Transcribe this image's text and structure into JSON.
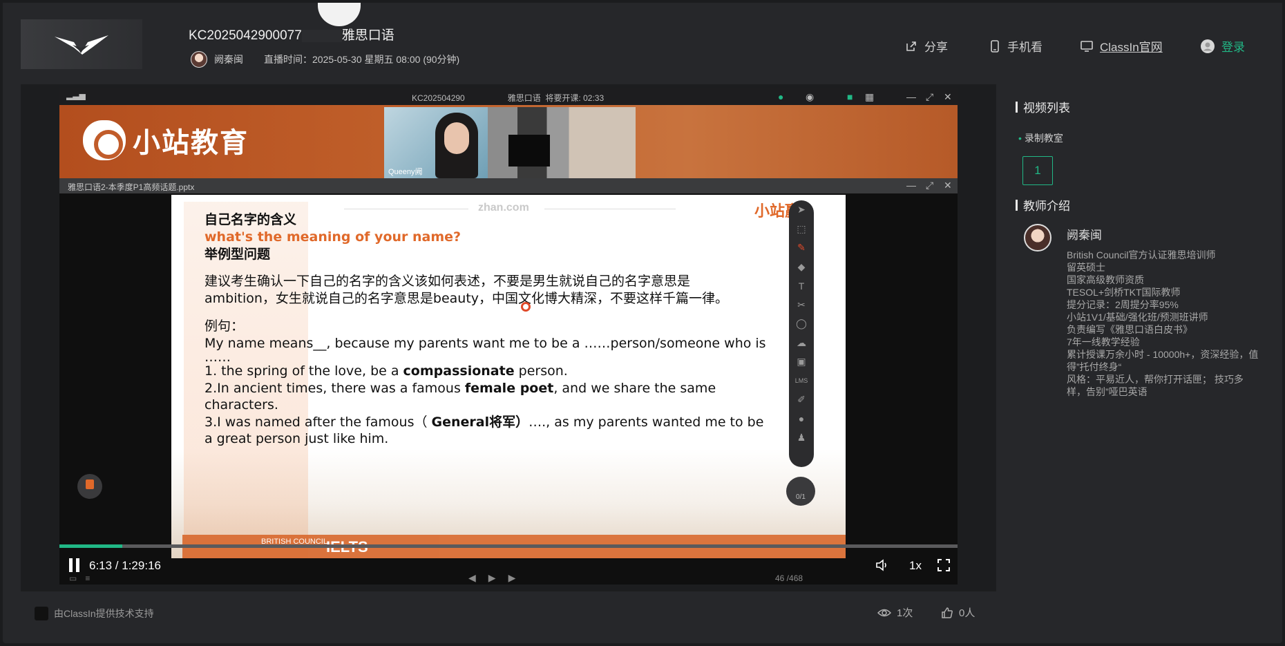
{
  "header": {
    "course_title_left": "KC2025042900077",
    "course_title_right": "雅思口语",
    "teacher": "阙秦闽",
    "broadcast_label": "直播时间：",
    "broadcast_time": "2025-05-30 星期五 08:00 (90分钟)",
    "share": "分享",
    "mobile": "手机看",
    "official": "ClassIn官网",
    "login": "登录"
  },
  "player": {
    "topbar_title_left": "KC202504290",
    "topbar_title_right": "雅思口语",
    "topbar_countdown": "将要开课: 02:33",
    "brand": "小站教育",
    "cam_name": "Queeny阙",
    "doc_filename": "雅思口语2-本季度P1高频话题.pptx",
    "slide": {
      "site": "zhan.com",
      "logo": "小站赢+",
      "heading_cn": "自己名字的含义",
      "heading_en": "what's the meaning of your name?",
      "type": "举例型问题",
      "advice_1": "建议考生确认一下自己的名字的含义该如何表述，不要是男生就说自己的名字意思是",
      "advice_2": "ambition，女生就说自己的名字意思是beauty，中国文化博大精深，不要这样千篇一律。",
      "example_label": "例句：",
      "ex_line1": "My name means__, because my parents want me to be a ……person/someone who is",
      "ex_line2": "……",
      "ex1_a": "1. the spring of the love, be a ",
      "ex1_b": "compassionate",
      "ex1_c": " person.",
      "ex2_a": "2.In ancient times, there was a famous ",
      "ex2_b": "female poet",
      "ex2_c": ", and we share the same",
      "ex2_d": "characters.",
      "ex3_a": "3.I was named after the famous（ ",
      "ex3_b": "General将军）",
      "ex3_c": "…., as my parents wanted me to be",
      "ex3_d": "a great person just like him.",
      "footer_bc": "BRITISH COUNCIL",
      "footer_ielts": "IELTS"
    },
    "page_indicator": "0/1",
    "mini_page": "1",
    "time": "6:13 / 1:29:16",
    "progress_fraction": 0.07,
    "speed": "1x",
    "slide_count": "46 /468"
  },
  "footer": {
    "powered": "由ClassIn提供技术支持",
    "views": "1次",
    "likes": "0人"
  },
  "sidebar": {
    "video_list_title": "视频列表",
    "recording_label": "录制教室",
    "episode": "1",
    "teacher_intro_title": "教师介绍",
    "teacher_name": "阙秦闽",
    "bio": [
      "British Council官方认证雅思培训师",
      "留英硕士",
      "国家高级教师资质",
      "TESOL+剑桥TKT国际教师",
      "提分记录：2周提分率95%",
      "小站1V1/基础/强化班/预测班讲师",
      "负责编写《雅思口语白皮书》",
      "7年一线教学经验",
      "累计授课万余小时 - 10000h+，资深经验，值得”托付终身“",
      "风格：平易近人，帮你打开话匣； 技巧多样，告别”哑巴英语"
    ]
  },
  "colors": {
    "accent": "#21b886",
    "brand_orange": "#e0692a",
    "background": "#26272a"
  }
}
